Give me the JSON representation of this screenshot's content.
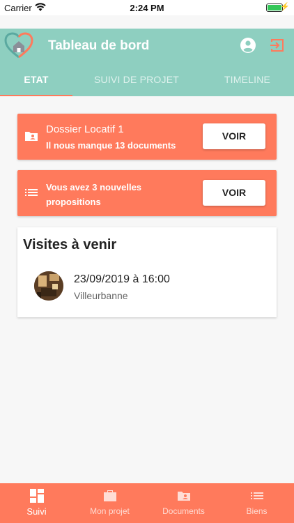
{
  "status_bar": {
    "carrier": "Carrier",
    "time": "2:24 PM"
  },
  "header": {
    "title": "Tableau de bord"
  },
  "tabs": [
    {
      "label": "ETAT",
      "active": true
    },
    {
      "label": "SUIVI DE PROJET",
      "active": false
    },
    {
      "label": "TIMELINE",
      "active": false
    }
  ],
  "cards": {
    "dossier": {
      "title": "Dossier Locatif 1",
      "subtitle": "Il nous manque 13 documents",
      "button": "VOIR",
      "icon": "folder-person-icon"
    },
    "propositions": {
      "text": "Vous avez 3 nouvelles propositions",
      "button": "VOIR",
      "icon": "list-icon"
    }
  },
  "visits": {
    "title": "Visites à venir",
    "items": [
      {
        "date": "23/09/2019 à 16:00",
        "city": "Villeurbanne"
      }
    ]
  },
  "bottom_nav": [
    {
      "label": "Suivi",
      "icon": "dashboard-icon",
      "active": true
    },
    {
      "label": "Mon projet",
      "icon": "briefcase-icon",
      "active": false
    },
    {
      "label": "Documents",
      "icon": "folder-person-icon",
      "active": false
    },
    {
      "label": "Biens",
      "icon": "list-icon",
      "active": false
    }
  ],
  "colors": {
    "header": "#8ecfc0",
    "accent": "#ff7a5c",
    "background": "#f7f7f7"
  }
}
